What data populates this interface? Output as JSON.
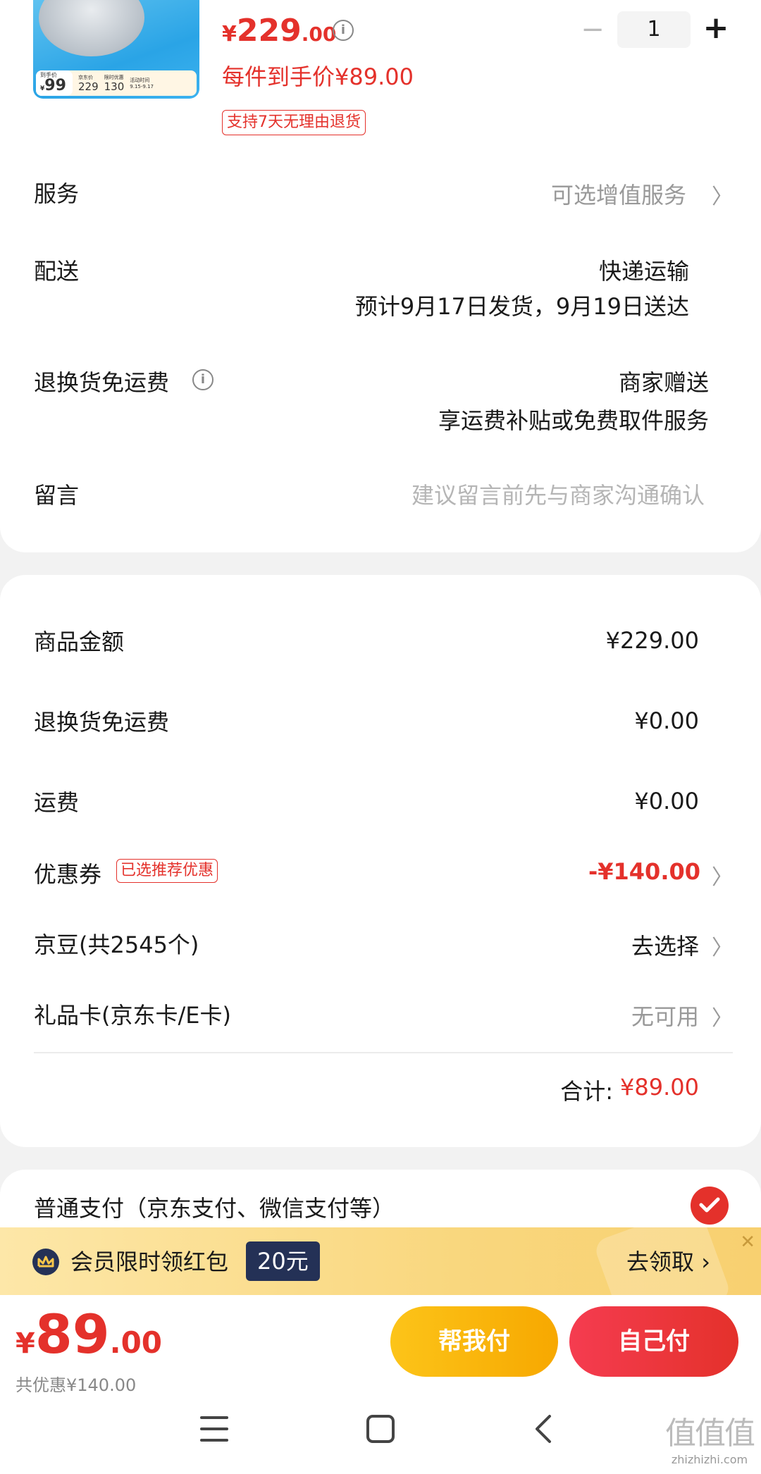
{
  "product": {
    "thumb": {
      "main_label": "到手价",
      "main_cur": "¥",
      "main_value": "99",
      "jd_label": "京东价",
      "jd_value": "229",
      "limit_label": "限时优惠",
      "limit_value": "130",
      "time_label": "活动时间",
      "time_value": "9.15-9.17"
    },
    "price_currency": "¥",
    "price_int": "229",
    "price_dec": ".00",
    "per_item_price": "每件到手价¥89.00",
    "return_tag": "支持7天无理由退货",
    "qty_minus": "−",
    "quantity": "1",
    "qty_plus": "+"
  },
  "details": {
    "service_label": "服务",
    "service_value": "可选增值服务",
    "delivery_label": "配送",
    "delivery_method": "快递运输",
    "delivery_eta": "预计9月17日发货，9月19日送达",
    "return_freight_label": "退换货免运费",
    "return_freight_value": "商家赠送",
    "return_freight_desc": "享运费补贴或免费取件服务",
    "message_label": "留言",
    "message_placeholder": "建议留言前先与商家沟通确认"
  },
  "summary": {
    "goods_label": "商品金额",
    "goods_value": "¥229.00",
    "return_freight_label": "退换货免运费",
    "return_freight_value": "¥0.00",
    "shipping_label": "运费",
    "shipping_value": "¥0.00",
    "coupon_label": "优惠券",
    "coupon_tag": "已选推荐优惠",
    "coupon_value": "-¥140.00",
    "jingdou_label": "京豆(共2545个)",
    "jingdou_value": "去选择",
    "giftcard_label": "礼品卡(京东卡/E卡)",
    "giftcard_value": "无可用",
    "total_label": "合计:",
    "total_value": "¥89.00"
  },
  "payment": {
    "method_label": "普通支付（京东支付、微信支付等）"
  },
  "banner": {
    "text": "会员限时领红包",
    "badge": "20元",
    "cta": "去领取 ›",
    "close": "✕"
  },
  "bottom": {
    "currency": "¥",
    "final_int": "89",
    "final_dec": ".00",
    "saved": "共优惠¥140.00",
    "help_pay": "帮我付",
    "self_pay": "自己付"
  },
  "watermark": {
    "big": "值值值",
    "small": "zhizhizhi.com"
  },
  "colors": {
    "accent_red": "#e4312b",
    "accent_yellow": "#fcc419",
    "banner_bg": "#f9d77e",
    "vip_navy": "#243156"
  },
  "icons": [
    "info-icon",
    "chevron-right-icon",
    "check-icon",
    "vip-crown-icon",
    "close-icon",
    "menu-icon",
    "home-icon",
    "back-icon"
  ]
}
